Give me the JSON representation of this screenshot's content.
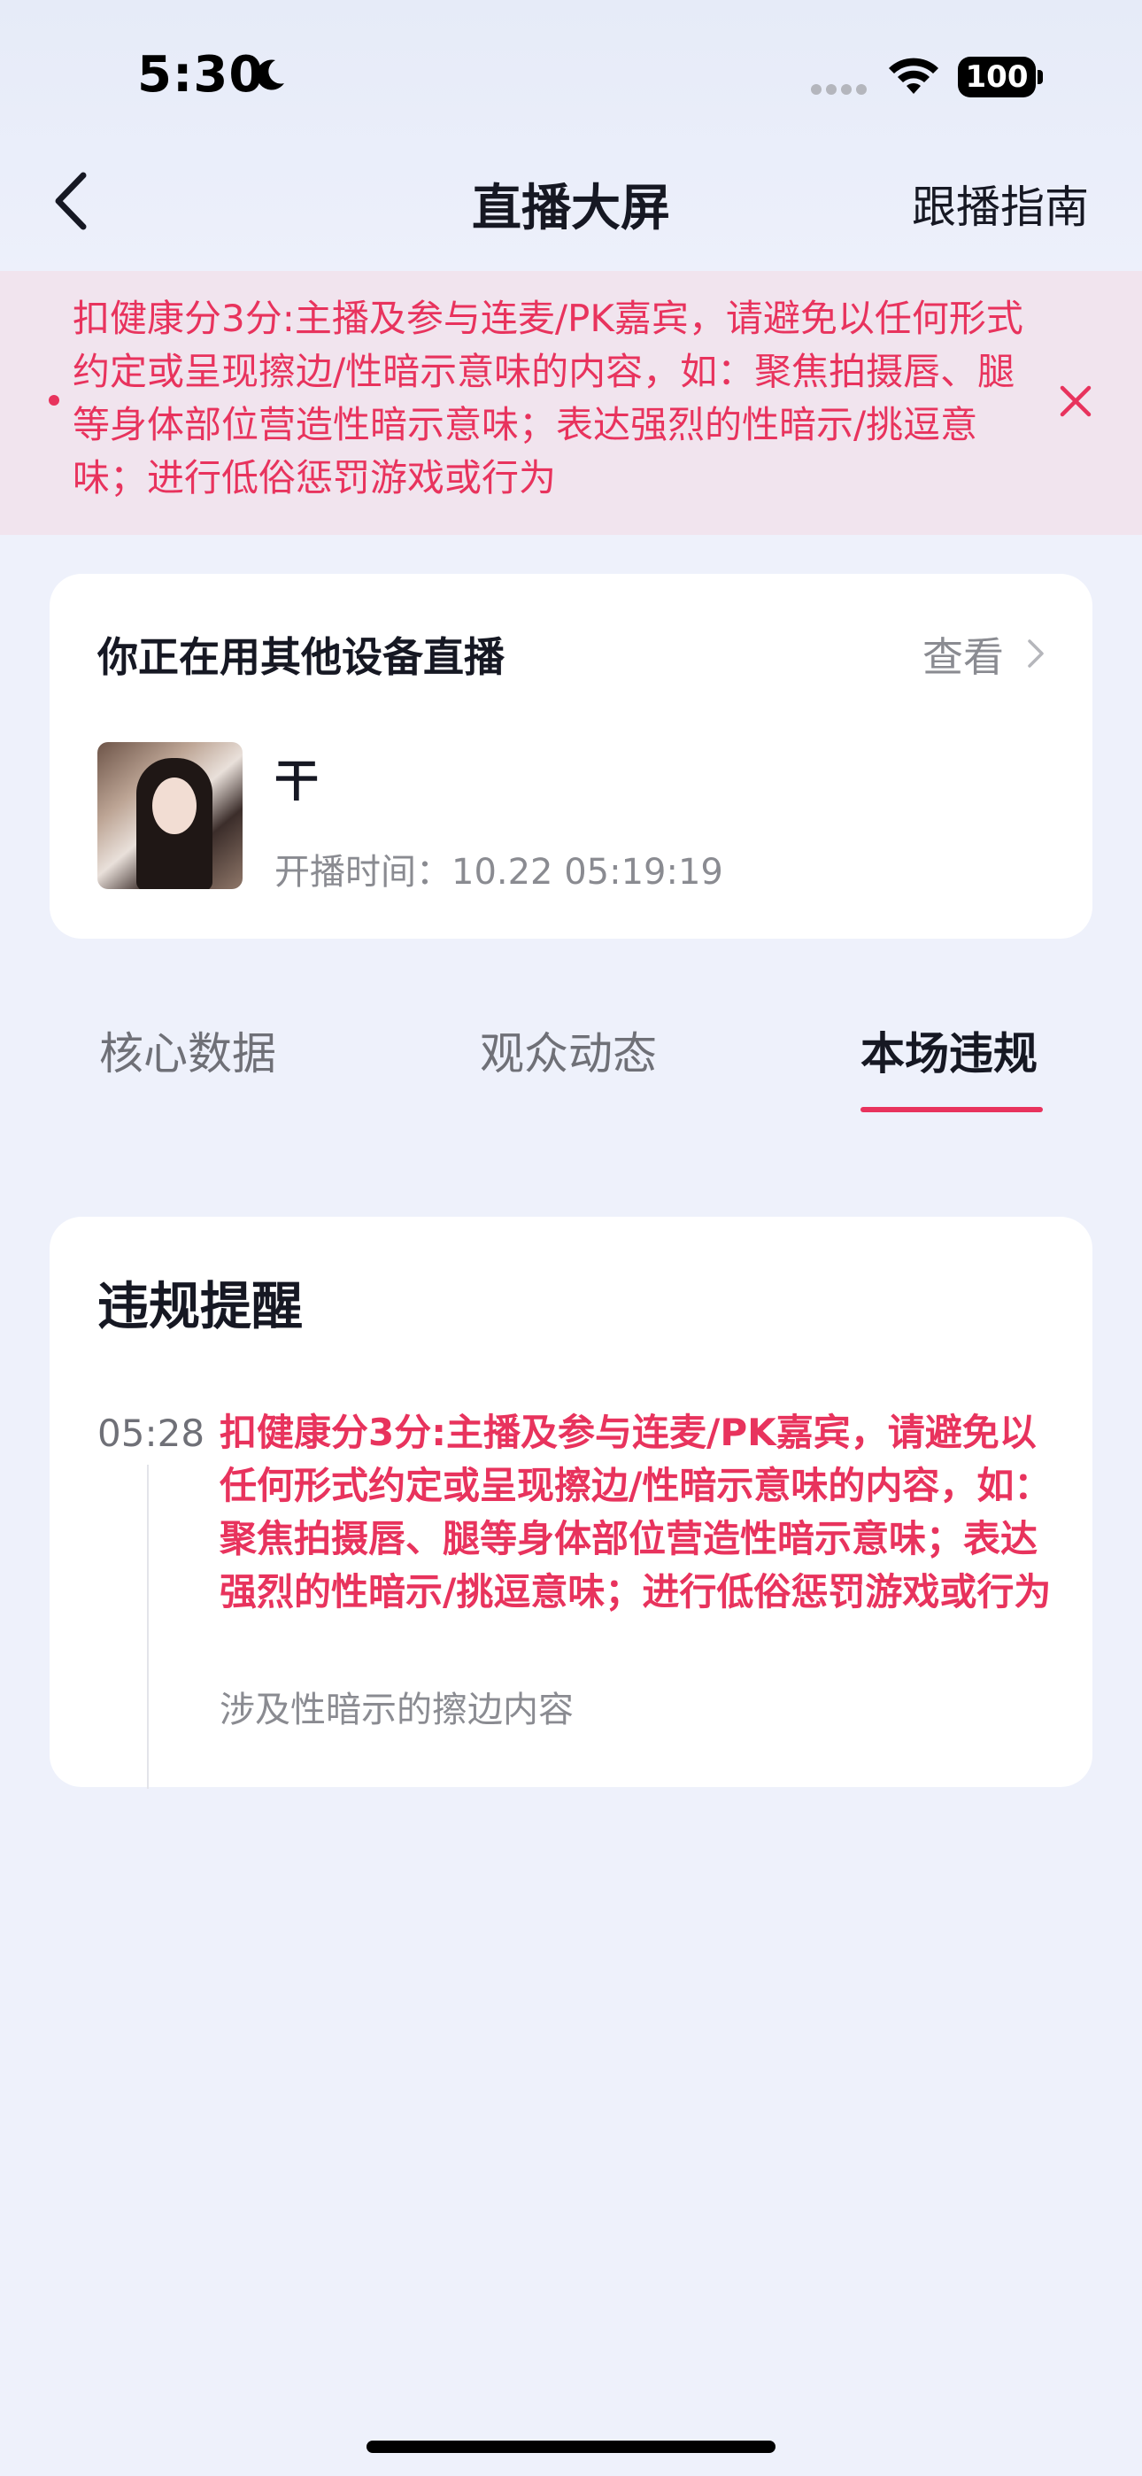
{
  "status_bar": {
    "time": "5:30",
    "battery": "100"
  },
  "nav": {
    "title": "直播大屏",
    "right_link": "跟播指南"
  },
  "banner": {
    "text": "扣健康分3分:主播及参与连麦/PK嘉宾，请避免以任何形式约定或呈现擦边/性暗示意味的内容，如：聚焦拍摄唇、腿等身体部位营造性暗示意味；表达强烈的性暗示/挑逗意味；进行低俗惩罚游戏或行为"
  },
  "live_card": {
    "title": "你正在用其他设备直播",
    "view_label": "查看",
    "username": "干",
    "start_time": "开播时间：10.22 05:19:19"
  },
  "tabs": [
    {
      "label": "核心数据"
    },
    {
      "label": "观众动态"
    },
    {
      "label": "本场违规",
      "active": true
    }
  ],
  "violations": {
    "title": "违规提醒",
    "items": [
      {
        "time": "05:28",
        "text": "扣健康分3分:主播及参与连麦/PK嘉宾，请避免以任何形式约定或呈现擦边/性暗示意味的内容，如：聚焦拍摄唇、腿等身体部位营造性暗示意味；表达强烈的性暗示/挑逗意味；进行低俗惩罚游戏或行为",
        "reason": "涉及性暗示的擦边内容"
      }
    ]
  },
  "colors": {
    "accent": "#e8335d",
    "background": "#eef1fb",
    "banner_bg": "#f1e4ee"
  }
}
